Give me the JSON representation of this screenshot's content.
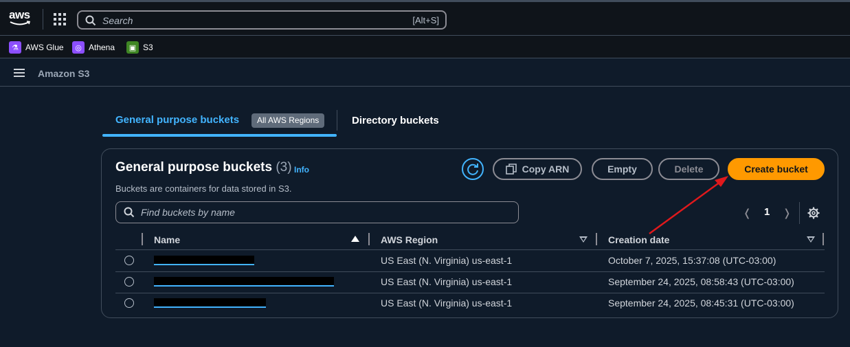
{
  "topbar": {
    "logo_text": "aws",
    "search_placeholder": "Search",
    "search_shortcut": "[Alt+S]"
  },
  "favorites": [
    {
      "label": "AWS Glue",
      "icon": "aws-glue-icon",
      "color": "#8c4fff"
    },
    {
      "label": "Athena",
      "icon": "athena-icon",
      "color": "#8c4fff"
    },
    {
      "label": "S3",
      "icon": "s3-icon",
      "color": "#3f8624"
    }
  ],
  "breadcrumb": {
    "service": "Amazon S3"
  },
  "tabs": {
    "general": "General purpose buckets",
    "general_badge": "All AWS Regions",
    "directory": "Directory buckets"
  },
  "panel": {
    "title": "General purpose buckets",
    "count": "(3)",
    "info": "Info",
    "description": "Buckets are containers for data stored in S3.",
    "buttons": {
      "copy_arn": "Copy ARN",
      "empty": "Empty",
      "delete": "Delete",
      "create": "Create bucket"
    },
    "find_placeholder": "Find buckets by name",
    "page": "1"
  },
  "table": {
    "columns": [
      "Name",
      "AWS Region",
      "Creation date"
    ],
    "rows": [
      {
        "region": "US East (N. Virginia) us-east-1",
        "created": "October 7, 2025, 15:37:08 (UTC-03:00)"
      },
      {
        "region": "US East (N. Virginia) us-east-1",
        "created": "September 24, 2025, 08:58:43 (UTC-03:00)"
      },
      {
        "region": "US East (N. Virginia) us-east-1",
        "created": "September 24, 2025, 08:45:31 (UTC-03:00)"
      }
    ]
  },
  "colors": {
    "accent": "#42b4ff",
    "primary_button": "#ff9900",
    "annotation_arrow": "#e0191c"
  }
}
